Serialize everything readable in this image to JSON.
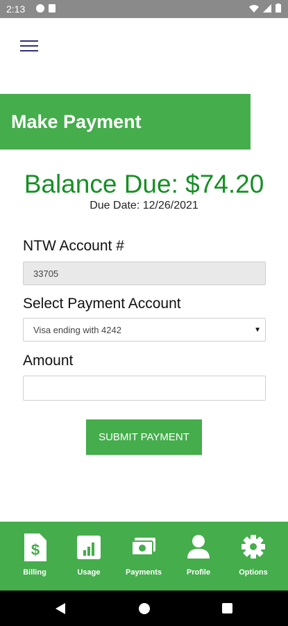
{
  "status_bar": {
    "time": "2:13"
  },
  "page": {
    "title": "Make Payment"
  },
  "balance": {
    "text": "Balance Due: $74.20",
    "due_date": "Due Date: 12/26/2021"
  },
  "form": {
    "account_label": "NTW Account #",
    "account_value": "33705",
    "payment_account_label": "Select Payment Account",
    "payment_account_selected": "Visa ending with 4242",
    "amount_label": "Amount",
    "amount_value": "",
    "submit_label": "SUBMIT PAYMENT"
  },
  "bottom_nav": {
    "items": [
      {
        "label": "Billing",
        "icon": "billing-icon"
      },
      {
        "label": "Usage",
        "icon": "usage-icon"
      },
      {
        "label": "Payments",
        "icon": "payments-icon"
      },
      {
        "label": "Profile",
        "icon": "profile-icon"
      },
      {
        "label": "Options",
        "icon": "gear-icon"
      }
    ]
  },
  "colors": {
    "brand_green": "#45ad4c",
    "balance_green": "#178f25",
    "menu_navy": "#2c2f7a"
  }
}
